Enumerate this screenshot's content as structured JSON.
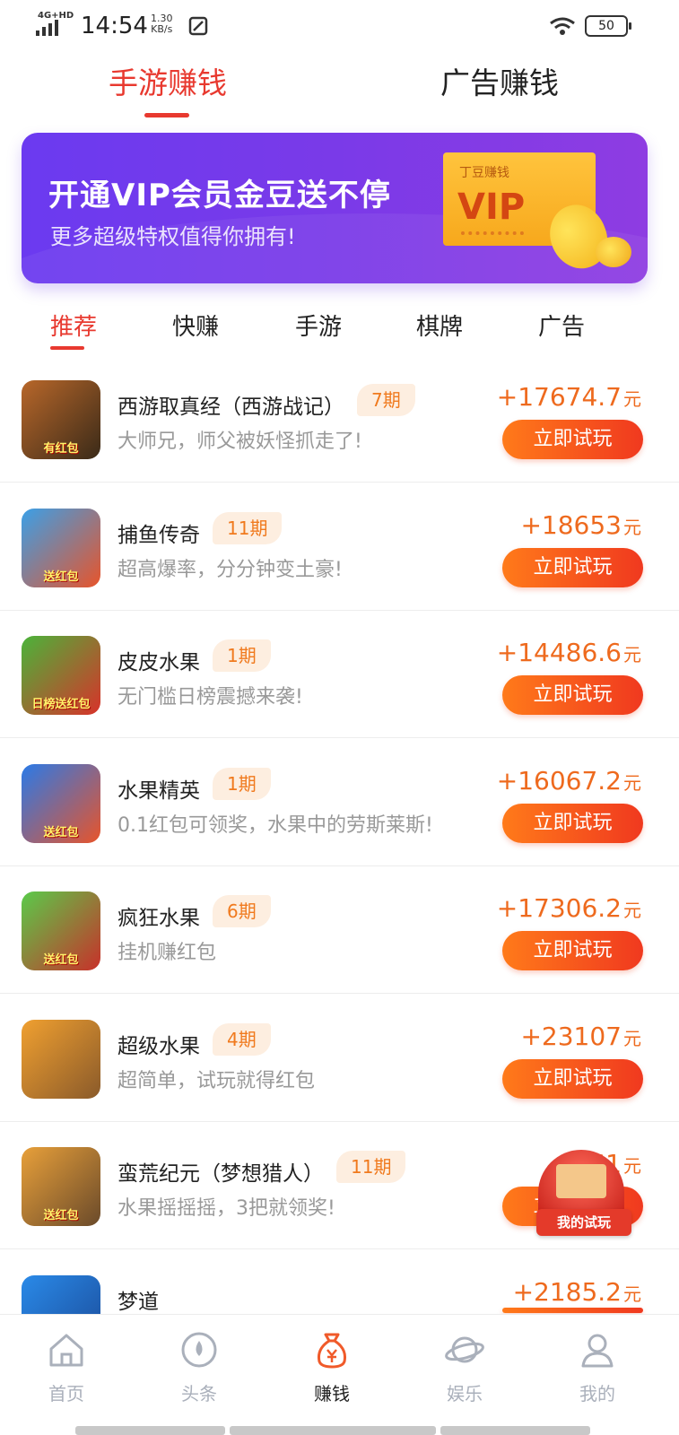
{
  "status_bar": {
    "network": "4G+HD",
    "time": "14:54",
    "speed_value": "1.30",
    "speed_unit": "KB/s",
    "battery": "50"
  },
  "top_tabs": [
    {
      "label": "手游赚钱",
      "active": true
    },
    {
      "label": "广告赚钱",
      "active": false
    }
  ],
  "banner": {
    "title": "开通VIP会员金豆送不停",
    "subtitle": "更多超级特权值得你拥有!",
    "card_brand": "丁豆赚钱",
    "card_vip": "VIP"
  },
  "category_tabs": [
    {
      "label": "推荐",
      "active": true
    },
    {
      "label": "快赚",
      "active": false
    },
    {
      "label": "手游",
      "active": false
    },
    {
      "label": "棋牌",
      "active": false
    },
    {
      "label": "广告",
      "active": false
    }
  ],
  "games": [
    {
      "name": "西游取真经（西游战记）",
      "period": "7期",
      "desc": "大师兄，师父被妖怪抓走了!",
      "amount": "+17674.7",
      "unit": "元",
      "button": "立即试玩",
      "icon_tag": "有红包",
      "icon_colors": [
        "#b8672a",
        "#3a2a18"
      ]
    },
    {
      "name": "捕鱼传奇",
      "period": "11期",
      "desc": "超高爆率，分分钟变土豪!",
      "amount": "+18653",
      "unit": "元",
      "button": "立即试玩",
      "icon_tag": "送红包",
      "icon_colors": [
        "#3aa0e8",
        "#e8542a"
      ]
    },
    {
      "name": "皮皮水果",
      "period": "1期",
      "desc": "无门槛日榜震撼来袭!",
      "amount": "+14486.6",
      "unit": "元",
      "button": "立即试玩",
      "icon_tag": "日榜送红包",
      "icon_colors": [
        "#4ab43a",
        "#d8322a"
      ]
    },
    {
      "name": "水果精英",
      "period": "1期",
      "desc": "0.1红包可领奖，水果中的劳斯莱斯!",
      "amount": "+16067.2",
      "unit": "元",
      "button": "立即试玩",
      "icon_tag": "送红包",
      "icon_colors": [
        "#2a7ae8",
        "#e8542a"
      ]
    },
    {
      "name": "疯狂水果",
      "period": "6期",
      "desc": "挂机赚红包",
      "amount": "+17306.2",
      "unit": "元",
      "button": "立即试玩",
      "icon_tag": "送红包",
      "icon_colors": [
        "#5acb4a",
        "#c8302a"
      ]
    },
    {
      "name": "超级水果",
      "period": "4期",
      "desc": "超简单，试玩就得红包",
      "amount": "+23107",
      "unit": "元",
      "button": "立即试玩",
      "icon_tag": "",
      "icon_colors": [
        "#f0a030",
        "#8a5a2a"
      ]
    },
    {
      "name": "蛮荒纪元（梦想猎人）",
      "period": "11期",
      "desc": "水果摇摇摇，3把就领奖!",
      "amount": "+161",
      "unit": "元",
      "button": "立即试玩",
      "icon_tag": "送红包",
      "icon_colors": [
        "#e8a03a",
        "#6a4a2a"
      ]
    },
    {
      "name": "梦道",
      "period": "",
      "desc": "",
      "amount": "+2185.2",
      "unit": "元",
      "button": "立即试玩",
      "icon_tag": "",
      "icon_colors": [
        "#2a8ae8",
        "#1a4a98"
      ]
    }
  ],
  "floating": {
    "label": "我的试玩"
  },
  "bottom_nav": [
    {
      "label": "首页",
      "icon": "home-icon",
      "active": false
    },
    {
      "label": "头条",
      "icon": "drop-icon",
      "active": false
    },
    {
      "label": "赚钱",
      "icon": "money-bag-icon",
      "active": true
    },
    {
      "label": "娱乐",
      "icon": "planet-icon",
      "active": false
    },
    {
      "label": "我的",
      "icon": "user-icon",
      "active": false
    }
  ],
  "colors": {
    "accent": "#e8392f",
    "amount": "#ee6a1e",
    "button_start": "#ff7a1a",
    "button_end": "#f0391f",
    "banner": "#7a3ae8"
  }
}
